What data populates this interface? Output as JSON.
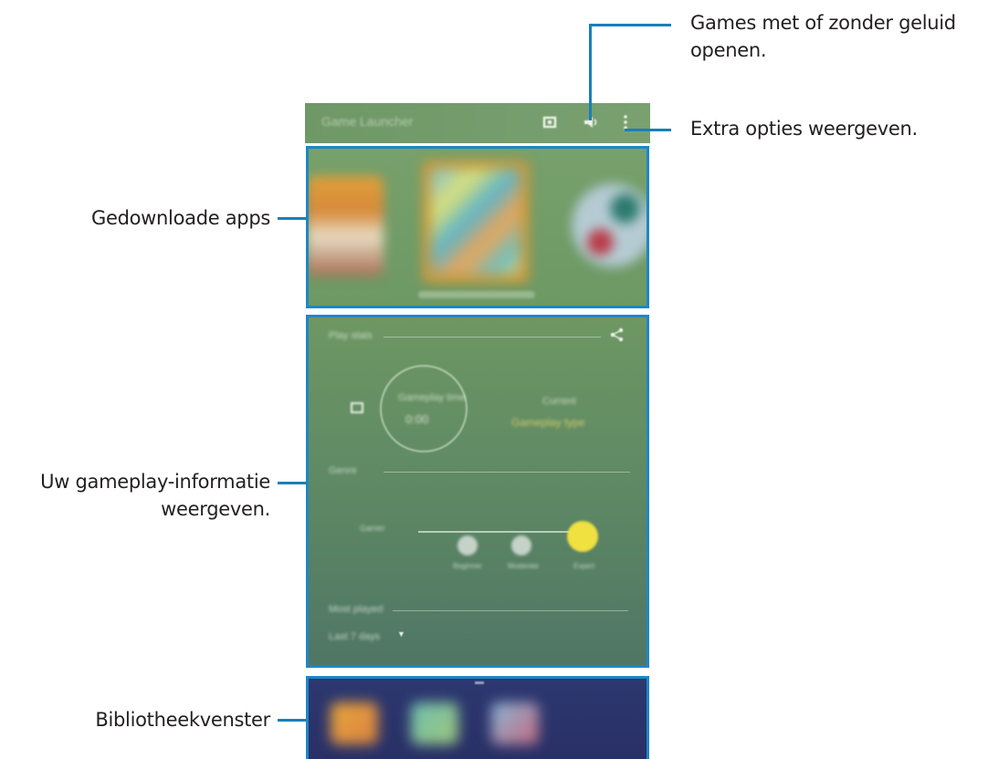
{
  "callouts": {
    "sound_line1": "Games met of zonder geluid",
    "sound_line2": "openen.",
    "more_options": "Extra opties weergeven.",
    "downloaded_apps": "Gedownloade apps",
    "gameplay_line1": "Uw gameplay-informatie",
    "gameplay_line2": "weergeven.",
    "library": "Bibliotheekvenster"
  },
  "app": {
    "title": "Game Launcher",
    "accent": "#1d87c6",
    "appbar_color": "#749d6b",
    "icons": [
      "screen-icon",
      "sound-icon",
      "more-options-icon"
    ]
  },
  "gameplay": {
    "section_title": "Play stats",
    "stat_label": "Gameplay time",
    "stat_value": "0:00",
    "level_caption": "Current",
    "level_value": "Gameplay type",
    "row_title": "Genre",
    "slider_levels": [
      "Beginner",
      "Moderate",
      "Expert"
    ],
    "slider_value_label": "Gamer",
    "filter_title": "Most played",
    "dropdown_value": "Last 7 days"
  }
}
